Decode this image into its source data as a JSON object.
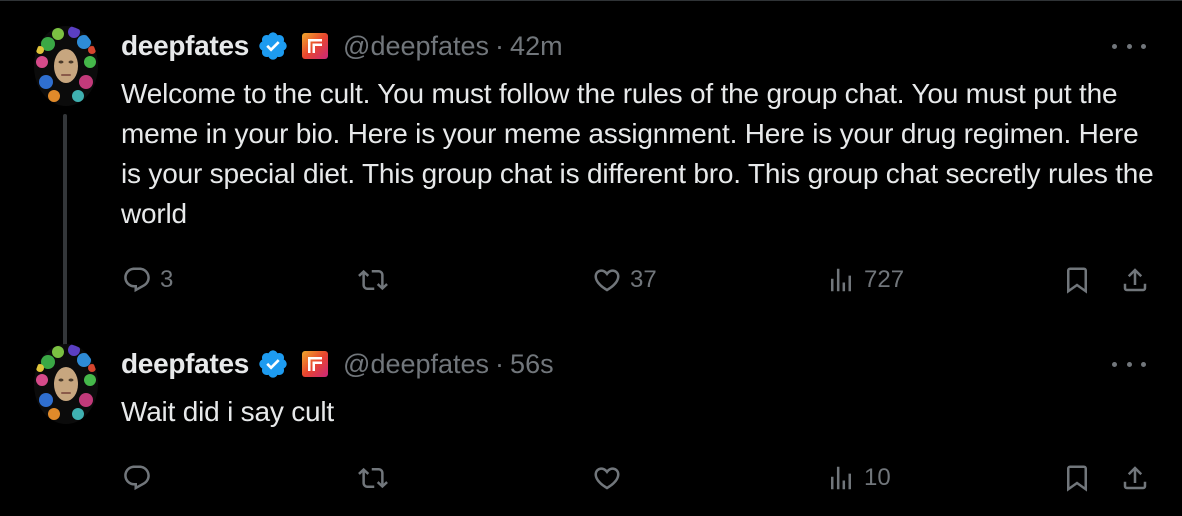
{
  "colors": {
    "background": "#000000",
    "text": "#e7e9ea",
    "muted": "#71767b",
    "verified": "#1d9bf0",
    "divider": "#2f3336"
  },
  "tweets": [
    {
      "display_name": "deepfates",
      "handle": "@deepfates",
      "separator": "·",
      "timestamp": "42m",
      "text": "Welcome to the cult. You must follow the rules of the group chat. You must put the meme in your bio. Here is your meme assignment. Here is your drug regimen. Here is your special diet. This group chat is different bro. This group chat secretly rules the world",
      "reply_count": "3",
      "retweet_count": "",
      "like_count": "37",
      "view_count": "727"
    },
    {
      "display_name": "deepfates",
      "handle": "@deepfates",
      "separator": "·",
      "timestamp": "56s",
      "text": "Wait did i say cult",
      "reply_count": "",
      "retweet_count": "",
      "like_count": "",
      "view_count": "10"
    }
  ],
  "icons": {
    "verified": "verified-badge-icon",
    "affiliate": "affiliate-badge-icon",
    "more": "more-icon",
    "reply": "reply-icon",
    "retweet": "retweet-icon",
    "like": "heart-icon",
    "views": "views-chart-icon",
    "bookmark": "bookmark-icon",
    "share": "share-icon"
  }
}
